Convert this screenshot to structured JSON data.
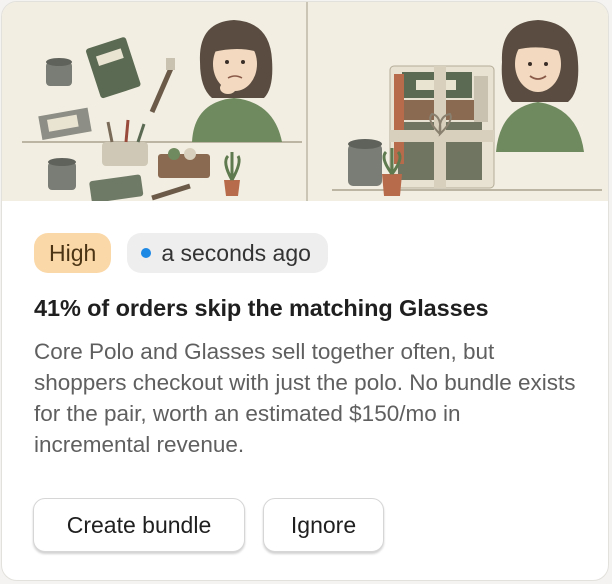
{
  "card": {
    "hero": {
      "left_scene": "worried person with scattered products",
      "right_scene": "smiling person with bundled products"
    },
    "priority_badge": "High",
    "time_badge": "a seconds ago",
    "status_color": "#1e88e5",
    "title": "41% of orders skip the matching Glasses",
    "description": "Core Polo and Glasses sell together often, but shoppers checkout with just the polo. No bundle exists for the pair, worth an estimated $150/mo in incremental revenue.",
    "actions": {
      "primary_label": "Create bundle",
      "secondary_label": "Ignore"
    }
  },
  "colors": {
    "priority_bg": "#fbd8a8",
    "hero_bg": "#f2eee2",
    "accent_green": "#6f8a5e"
  }
}
